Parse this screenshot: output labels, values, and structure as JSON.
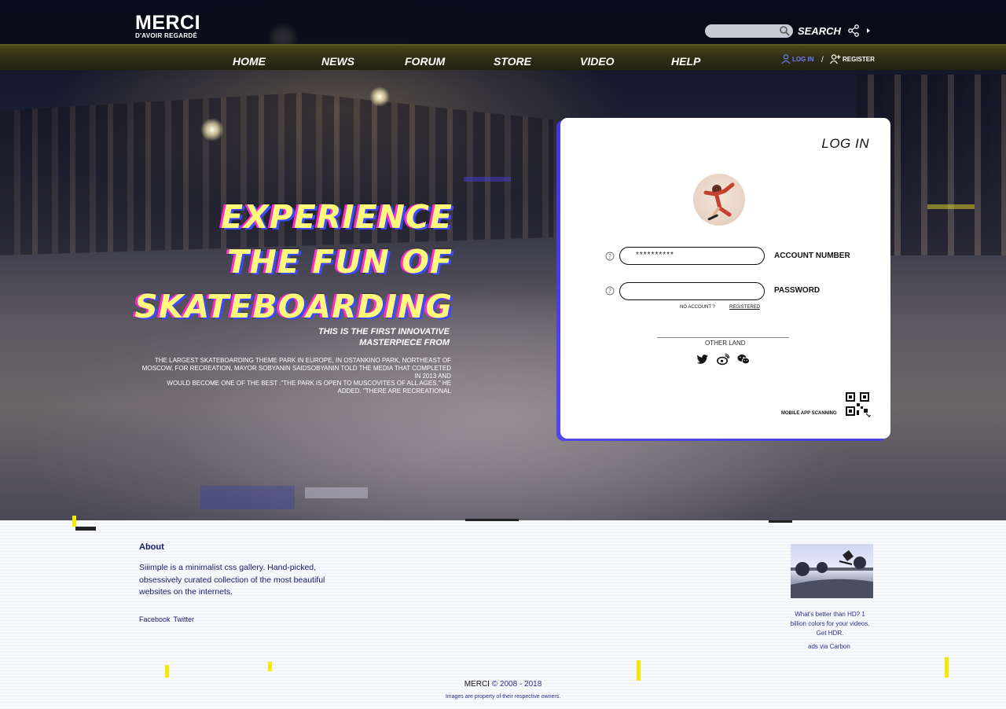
{
  "brand": {
    "name": "MERCI",
    "tagline": "D'AVOIR REGARDÉ"
  },
  "search": {
    "placeholder": "",
    "label": "SEARCH"
  },
  "nav": {
    "items": [
      "HOME",
      "NEWS",
      "FORUM",
      "STORE",
      "VIDEO",
      "HELP"
    ],
    "login": "LOG IN",
    "separator": "/",
    "register": "REGISTER"
  },
  "hero": {
    "headline": [
      "EXPERIENCE",
      "THE FUN OF",
      "SKATEBOARDING"
    ],
    "subhead": [
      "THIS IS THE FIRST INNOVATIVE",
      "MASTERPIECE FROM"
    ],
    "body": [
      "THE LARGEST SKATEBOARDING THEME PARK IN EUROPE, IN OSTANKINO PARK, NORTHEAST OF",
      "MOSCOW, FOR RECREATION, MAYOR SOBYANIN SAIDSOBYANIN TOLD THE MEDIA THAT COMPLETED",
      "IN 2013 AND",
      "WOULD BECOME ONE OF THE BEST .\"THE PARK IS OPEN TO MUSCOVITES OF ALL AGES,\" HE",
      "ADDED. \"THERE ARE RECREATIONAL"
    ]
  },
  "login": {
    "title": "LOG IN",
    "account_value": "**********",
    "account_label": "ACCOUNT NUMBER",
    "password_value": "",
    "password_label": "PASSWORD",
    "no_account": "NO ACCOUNT ?",
    "registered": "REGISTERED",
    "other_land": "OTHER LAND",
    "social_icons": [
      "twitter-icon",
      "weibo-icon",
      "wechat-icon"
    ],
    "mobile_scan": "MOBILE APP SCANNING"
  },
  "footer": {
    "about_title": "About",
    "about_text": [
      "Siiimple is a minimalist css gallery. Hand-picked,",
      "obsessively curated collection of the most beautiful",
      "websites on the internets."
    ],
    "links": [
      "Facebook",
      "Twitter"
    ],
    "ad_text": [
      "What's better than HD? 1",
      "billion colors for your videos.",
      "Get HDR."
    ],
    "ad_via": "ads via Carbon",
    "copyright_name": "MERCI",
    "copyright_years": "© 2008 - 2018",
    "rights": "Images are property of their respective owners."
  },
  "colors": {
    "accent_blue": "#3b49ff",
    "accent_pink": "#ff2bd0",
    "accent_yellow": "#fffb7a",
    "footer_text": "#15186a"
  }
}
